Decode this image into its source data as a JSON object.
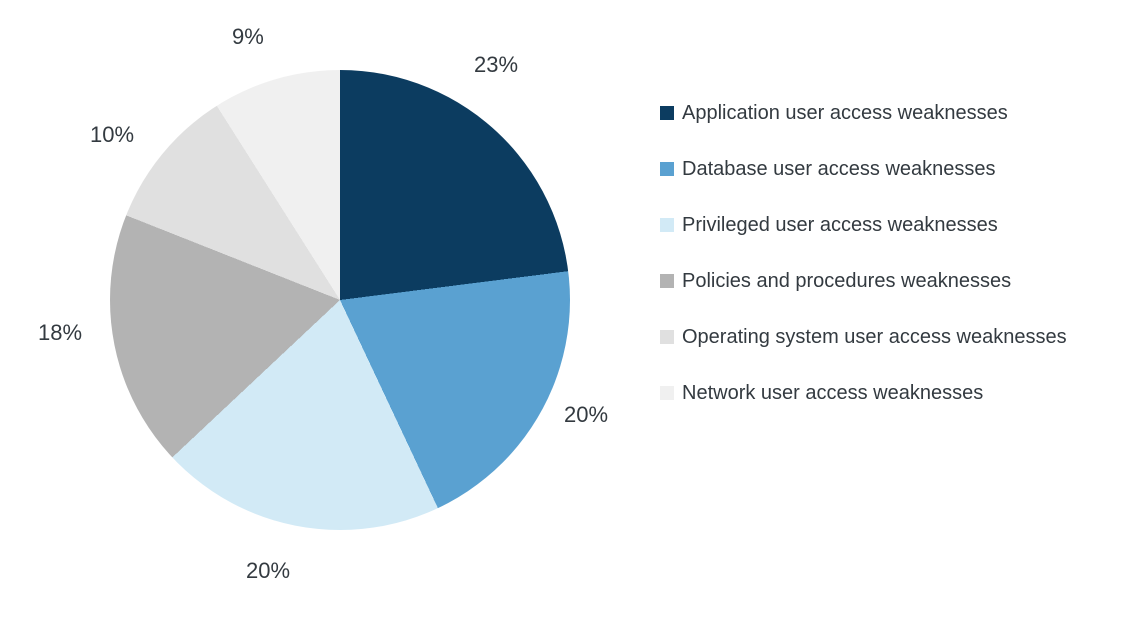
{
  "chart_data": {
    "type": "pie",
    "series": [
      {
        "name": "Application user access weaknesses",
        "value": 23,
        "label": "23%",
        "color": "#0c3c60"
      },
      {
        "name": "Database user access weaknesses",
        "value": 20,
        "label": "20%",
        "color": "#5aa1d1"
      },
      {
        "name": "Privileged user access weaknesses",
        "value": 20,
        "label": "20%",
        "color": "#d2eaf6"
      },
      {
        "name": "Policies and procedures weaknesses",
        "value": 18,
        "label": "18%",
        "color": "#b3b3b3"
      },
      {
        "name": "Operating system user access weaknesses",
        "value": 10,
        "label": "10%",
        "color": "#e0e0e0"
      },
      {
        "name": "Network user access weaknesses",
        "value": 9,
        "label": "9%",
        "color": "#f0f0f0"
      }
    ]
  },
  "slice_labels": {
    "s0": "23%",
    "s1": "20%",
    "s2": "20%",
    "s3": "18%",
    "s4": "10%",
    "s5": "9%"
  },
  "legend": {
    "l0": "Application user access weaknesses",
    "l1": "Database user access weaknesses",
    "l2": "Privileged user access weaknesses",
    "l3": "Policies and procedures weaknesses",
    "l4": "Operating system user access weaknesses",
    "l5": "Network user access weaknesses"
  },
  "colors": {
    "c0": "#0c3c60",
    "c1": "#5aa1d1",
    "c2": "#d2eaf6",
    "c3": "#b3b3b3",
    "c4": "#e0e0e0",
    "c5": "#f0f0f0"
  }
}
